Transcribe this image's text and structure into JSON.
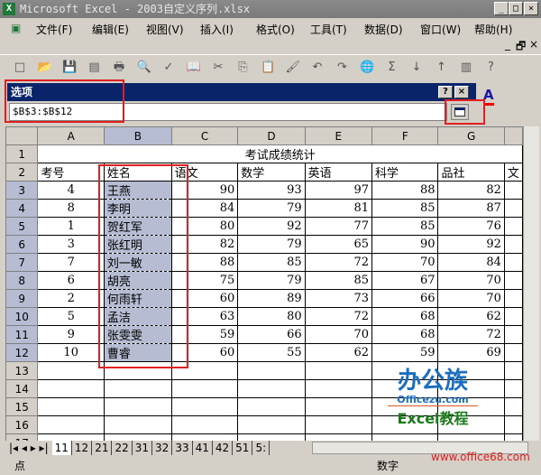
{
  "window": {
    "title": "Microsoft Excel - 2003自定义序列.xlsx",
    "min": "_",
    "max": "□",
    "close": "×"
  },
  "menu": [
    "文件(F)",
    "编辑(E)",
    "视图(V)",
    "插入(I)",
    "格式(O)",
    "工具(T)",
    "数据(D)",
    "窗口(W)",
    "帮助(H)"
  ],
  "toolbar_icons": [
    "new-icon",
    "open-icon",
    "save-icon",
    "permission-icon",
    "print-icon",
    "print-preview-icon",
    "spelling-icon",
    "research-icon",
    "cut-icon",
    "copy-icon",
    "paste-icon",
    "format-painter-icon",
    "undo-icon",
    "redo-icon",
    "hyperlink-icon",
    "autosum-icon",
    "sort-asc-icon",
    "sort-desc-icon",
    "chart-icon",
    "help-icon"
  ],
  "dialog": {
    "title": "选项",
    "help": "?",
    "close": "×",
    "value": "$B$3:$B$12"
  },
  "font_color_label": "A",
  "columns": [
    "A",
    "B",
    "C",
    "D",
    "E",
    "F",
    "G"
  ],
  "sheet": {
    "title": "考试成绩统计",
    "headers": [
      "考号",
      "姓名",
      "语文",
      "数学",
      "英语",
      "科学",
      "品社",
      "文"
    ],
    "rows": [
      [
        "4",
        "王燕",
        "90",
        "93",
        "97",
        "88",
        "82"
      ],
      [
        "8",
        "李明",
        "84",
        "79",
        "81",
        "85",
        "87"
      ],
      [
        "1",
        "贺红军",
        "80",
        "92",
        "77",
        "85",
        "76"
      ],
      [
        "3",
        "张红明",
        "82",
        "79",
        "65",
        "90",
        "92"
      ],
      [
        "7",
        "刘一敏",
        "88",
        "85",
        "72",
        "70",
        "84"
      ],
      [
        "6",
        "胡亮",
        "75",
        "79",
        "85",
        "67",
        "70"
      ],
      [
        "2",
        "何雨轩",
        "60",
        "89",
        "73",
        "66",
        "70"
      ],
      [
        "5",
        "孟洁",
        "63",
        "80",
        "72",
        "68",
        "62"
      ],
      [
        "9",
        "张雯雯",
        "59",
        "66",
        "70",
        "68",
        "72"
      ],
      [
        "10",
        "曹睿",
        "60",
        "55",
        "62",
        "59",
        "69"
      ]
    ],
    "empty_rows": [
      "13",
      "14",
      "15",
      "16",
      "17"
    ]
  },
  "tabs": [
    "11",
    "12",
    "21",
    "22",
    "31",
    "32",
    "33",
    "41",
    "42",
    "51",
    "5:"
  ],
  "status": {
    "mode": "点",
    "numlock": "数字"
  },
  "watermark": {
    "brand": "办公族",
    "site": "Officezu.com",
    "course": "Excel教程",
    "url": "www.office68.com"
  },
  "colors": {
    "selection": "#b6bdd2",
    "dialog_title": "#0a246a",
    "highlight_box": "#e02020"
  }
}
